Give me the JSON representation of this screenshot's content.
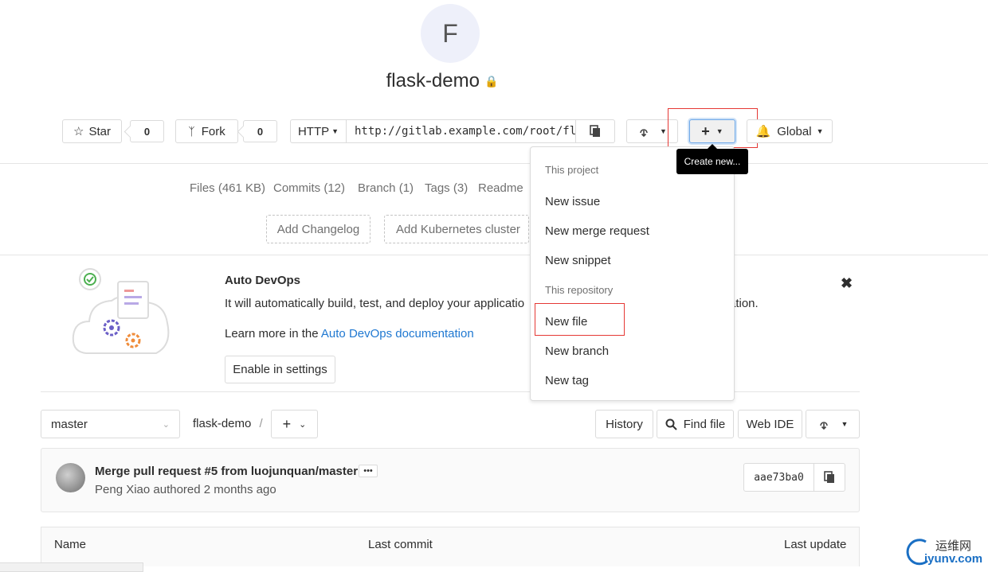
{
  "project": {
    "avatar_letter": "F",
    "name": "flask-demo",
    "lock_icon": "lock-icon"
  },
  "actions": {
    "star_label": "Star",
    "star_count": "0",
    "fork_label": "Fork",
    "fork_count": "0",
    "clone_protocol": "HTTP",
    "clone_url": "http://gitlab.example.com/root/flask-demo.git",
    "notification_label": "Global"
  },
  "tooltip": "Create new...",
  "dropdown": {
    "project_header": "This project",
    "project_items": [
      "New issue",
      "New merge request",
      "New snippet"
    ],
    "repo_header": "This repository",
    "repo_items": [
      "New file",
      "New branch",
      "New tag"
    ]
  },
  "stats": {
    "files": "Files (461 KB)",
    "commits": "Commits (12)",
    "branch": "Branch (1)",
    "tags": "Tags (3)",
    "readme": "Readme"
  },
  "quick_buttons": {
    "changelog": "Add Changelog",
    "kubernetes": "Add Kubernetes cluster"
  },
  "devops": {
    "title": "Auto DevOps",
    "text": "It will automatically build, test, and deploy your applicatio",
    "text_tail": "ration.",
    "learn_prefix": "Learn more in the",
    "learn_link": "Auto DevOps documentation",
    "enable_button": "Enable in settings"
  },
  "tree": {
    "branch": "master",
    "path": "flask-demo",
    "history": "History",
    "find_file": "Find file",
    "web_ide": "Web IDE"
  },
  "commit": {
    "title": "Merge pull request #5 from luojunquan/master",
    "meta": "Peng Xiao authored 2 months ago",
    "sha": "aae73ba0"
  },
  "table": {
    "col_name": "Name",
    "col_last_commit": "Last commit",
    "col_last_update": "Last update"
  },
  "watermark": {
    "line1": "运维网",
    "line2": "iyunv.com"
  }
}
